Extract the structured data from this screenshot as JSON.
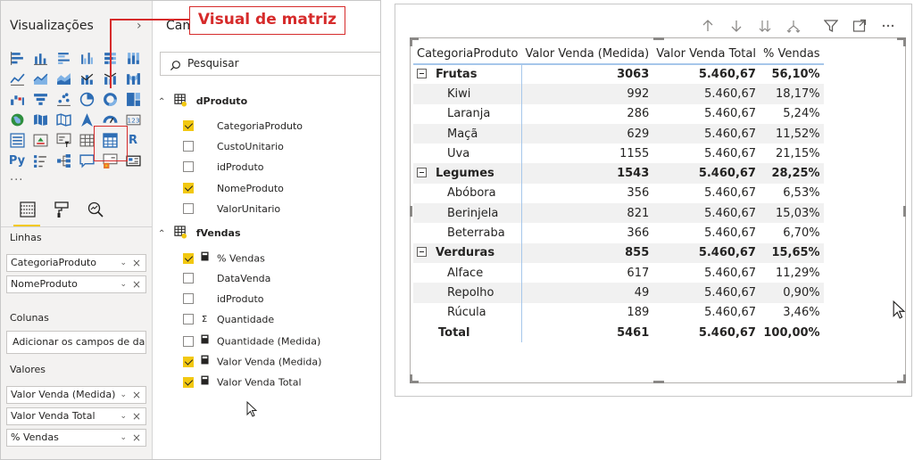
{
  "viz_pane": {
    "title": "Visualizações",
    "more": "...",
    "field_wells": [
      {
        "label": "Linhas",
        "items": [
          "CategoriaProduto",
          "NomeProduto"
        ]
      },
      {
        "label": "Colunas",
        "placeholder": "Adicionar os campos de da..."
      },
      {
        "label": "Valores",
        "items": [
          "Valor Venda (Medida)",
          "Valor Venda Total",
          "% Vendas"
        ]
      }
    ]
  },
  "fields_pane": {
    "title": "Cam",
    "search_placeholder": "Pesquisar",
    "tables": [
      {
        "name": "dProduto",
        "fields": [
          {
            "name": "CategoriaProduto",
            "checked": true,
            "type": ""
          },
          {
            "name": "CustoUnitario",
            "checked": false,
            "type": ""
          },
          {
            "name": "idProduto",
            "checked": false,
            "type": ""
          },
          {
            "name": "NomeProduto",
            "checked": true,
            "type": ""
          },
          {
            "name": "ValorUnitario",
            "checked": false,
            "type": ""
          }
        ]
      },
      {
        "name": "fVendas",
        "fields": [
          {
            "name": "% Vendas",
            "checked": true,
            "type": "measure"
          },
          {
            "name": "DataVenda",
            "checked": false,
            "type": ""
          },
          {
            "name": "idProduto",
            "checked": false,
            "type": ""
          },
          {
            "name": "Quantidade",
            "checked": false,
            "type": "sum"
          },
          {
            "name": "Quantidade (Medida)",
            "checked": false,
            "type": "measure"
          },
          {
            "name": "Valor Venda (Medida)",
            "checked": true,
            "type": "measure"
          },
          {
            "name": "Valor Venda Total",
            "checked": true,
            "type": "measure"
          }
        ]
      }
    ]
  },
  "callout": "Visual de matriz",
  "symbols": {
    "sum": "Σ",
    "chevron_right": "›",
    "chevron_down": "⌄",
    "close": "×",
    "expanded": "⌃"
  },
  "matrix": {
    "headers": [
      "CategoriaProduto",
      "Valor Venda (Medida)",
      "Valor Venda Total",
      "% Vendas"
    ],
    "groups": [
      {
        "name": "Frutas",
        "values": [
          "3063",
          "5.460,67",
          "56,10%"
        ],
        "children": [
          {
            "name": "Kiwi",
            "values": [
              "992",
              "5.460,67",
              "18,17%"
            ]
          },
          {
            "name": "Laranja",
            "values": [
              "286",
              "5.460,67",
              "5,24%"
            ]
          },
          {
            "name": "Maçã",
            "values": [
              "629",
              "5.460,67",
              "11,52%"
            ]
          },
          {
            "name": "Uva",
            "values": [
              "1155",
              "5.460,67",
              "21,15%"
            ]
          }
        ]
      },
      {
        "name": "Legumes",
        "values": [
          "1543",
          "5.460,67",
          "28,25%"
        ],
        "children": [
          {
            "name": "Abóbora",
            "values": [
              "356",
              "5.460,67",
              "6,53%"
            ]
          },
          {
            "name": "Berinjela",
            "values": [
              "821",
              "5.460,67",
              "15,03%"
            ]
          },
          {
            "name": "Beterraba",
            "values": [
              "366",
              "5.460,67",
              "6,70%"
            ]
          }
        ]
      },
      {
        "name": "Verduras",
        "values": [
          "855",
          "5.460,67",
          "15,65%"
        ],
        "children": [
          {
            "name": "Alface",
            "values": [
              "617",
              "5.460,67",
              "11,29%"
            ]
          },
          {
            "name": "Repolho",
            "values": [
              "49",
              "5.460,67",
              "0,90%"
            ]
          },
          {
            "name": "Rúcula",
            "values": [
              "189",
              "5.460,67",
              "3,46%"
            ]
          }
        ]
      }
    ],
    "total": {
      "name": "Total",
      "values": [
        "5461",
        "5.460,67",
        "100,00%"
      ]
    }
  },
  "colors": {
    "accent": "#f2c811",
    "callout": "#d62b2b",
    "matrix_line": "#a6c7ea",
    "row_shade": "#f1f1f1"
  }
}
